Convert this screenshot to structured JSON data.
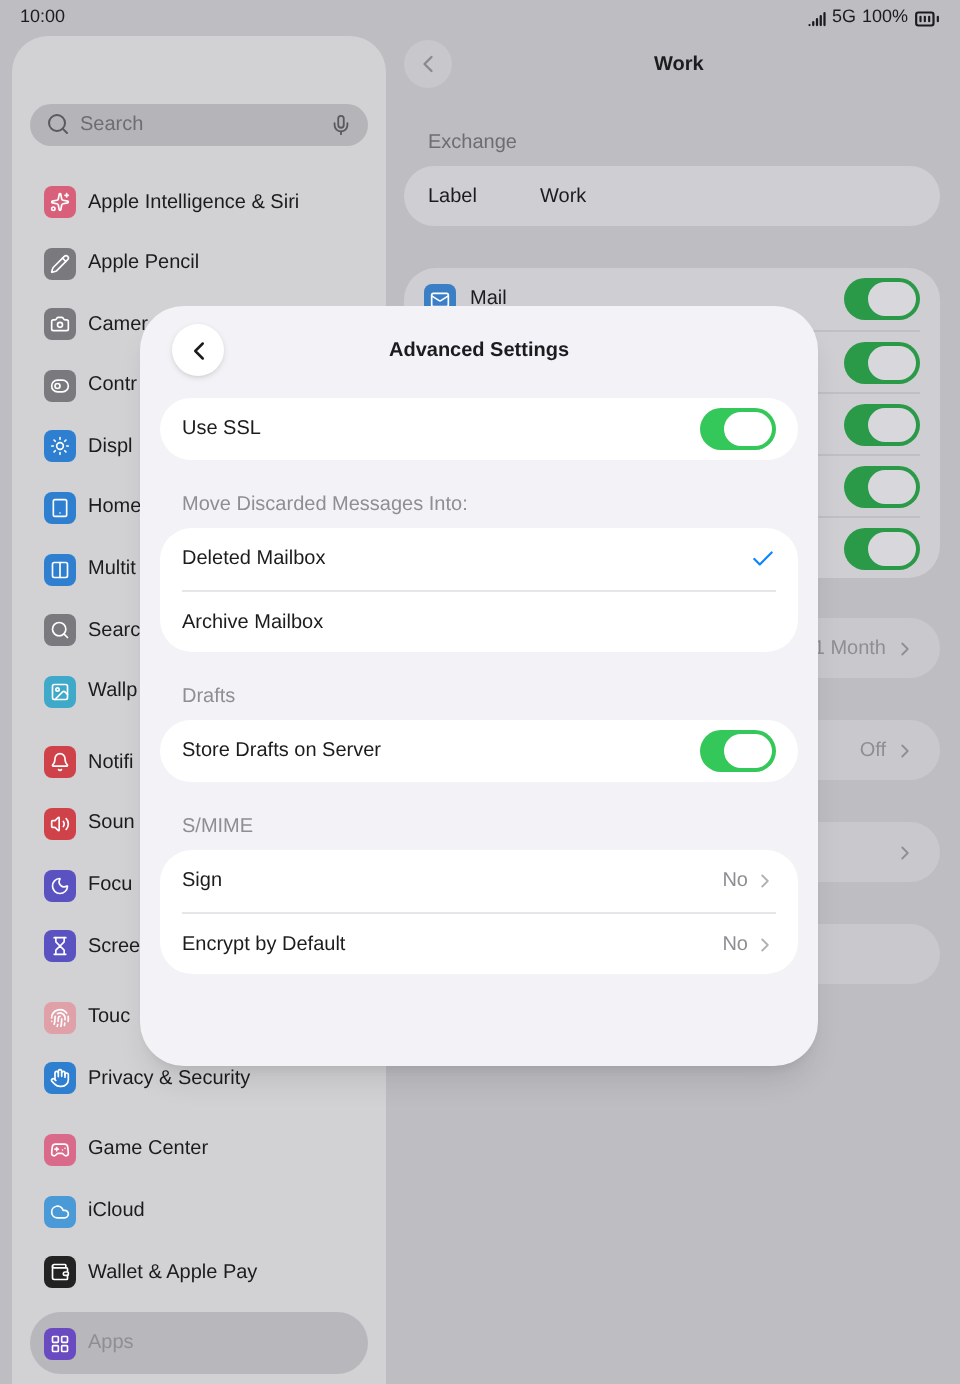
{
  "status_bar": {
    "time": "10:00",
    "network": "5G",
    "battery": "100%"
  },
  "sidebar": {
    "search": {
      "placeholder": "Search"
    },
    "groups": [
      [
        {
          "label": "Apple Intelligence & Siri",
          "color": "#d9607a",
          "selected": false
        },
        {
          "label": "Apple Pencil",
          "color": "#7a7a7e",
          "selected": false
        },
        {
          "label": "Camer",
          "color": "#7a7a7e",
          "selected": false
        },
        {
          "label": "Contr",
          "color": "#7a7a7e",
          "selected": false
        },
        {
          "label": "Displ",
          "color": "#2f7fd0",
          "selected": false
        },
        {
          "label": "Home",
          "color": "#2f7fd0",
          "selected": false
        },
        {
          "label": "Multit",
          "color": "#2f7fd0",
          "selected": false
        },
        {
          "label": "Searc",
          "color": "#7a7a7e",
          "selected": false
        },
        {
          "label": "Wallp",
          "color": "#3fa9c9",
          "selected": false
        }
      ],
      [
        {
          "label": "Notifi",
          "color": "#d0424a",
          "selected": false
        },
        {
          "label": "Soun",
          "color": "#d0424a",
          "selected": false
        },
        {
          "label": "Focu",
          "color": "#5b52c2",
          "selected": false
        },
        {
          "label": "Scree",
          "color": "#5b52c2",
          "selected": false
        }
      ],
      [
        {
          "label": "Touc",
          "color": "#e0a0a8",
          "selected": false
        },
        {
          "label": "Privacy & Security",
          "color": "#2f7fd0",
          "selected": false
        }
      ],
      [
        {
          "label": "Game Center",
          "color": "#d96a8a",
          "selected": false
        },
        {
          "label": "iCloud",
          "color": "#4a9ad8",
          "selected": false
        },
        {
          "label": "Wallet & Apple Pay",
          "color": "#222222",
          "selected": false
        }
      ],
      [
        {
          "label": "Apps",
          "color": "#6a4ac0",
          "selected": true
        }
      ]
    ]
  },
  "detail": {
    "title": "Work",
    "section": "Exchange",
    "label_row": {
      "label": "Label",
      "value": "Work"
    },
    "toggles": [
      {
        "label": "Mail",
        "on": true
      },
      {
        "on": true
      },
      {
        "on": true
      },
      {
        "on": true
      },
      {
        "on": true
      }
    ],
    "rows": [
      {
        "kind": "link",
        "value": "1 Month"
      },
      {
        "kind": "link",
        "value": "Off"
      },
      {
        "kind": "link"
      },
      {
        "kind": "plain"
      }
    ]
  },
  "modal": {
    "title": "Advanced Settings",
    "sections": [
      {
        "rows": [
          {
            "kind": "toggle",
            "label": "Use SSL",
            "on": true
          }
        ]
      },
      {
        "header": "Move Discarded Messages Into:",
        "rows": [
          {
            "kind": "choice",
            "label": "Deleted Mailbox",
            "selected": true
          },
          {
            "kind": "choice",
            "label": "Archive Mailbox",
            "selected": false
          }
        ]
      },
      {
        "header": "Drafts",
        "rows": [
          {
            "kind": "toggle",
            "label": "Store Drafts on Server",
            "on": true
          }
        ]
      },
      {
        "header": "S/MIME",
        "rows": [
          {
            "kind": "link",
            "label": "Sign",
            "value": "No"
          },
          {
            "kind": "link",
            "label": "Encrypt by Default",
            "value": "No"
          }
        ]
      }
    ]
  }
}
